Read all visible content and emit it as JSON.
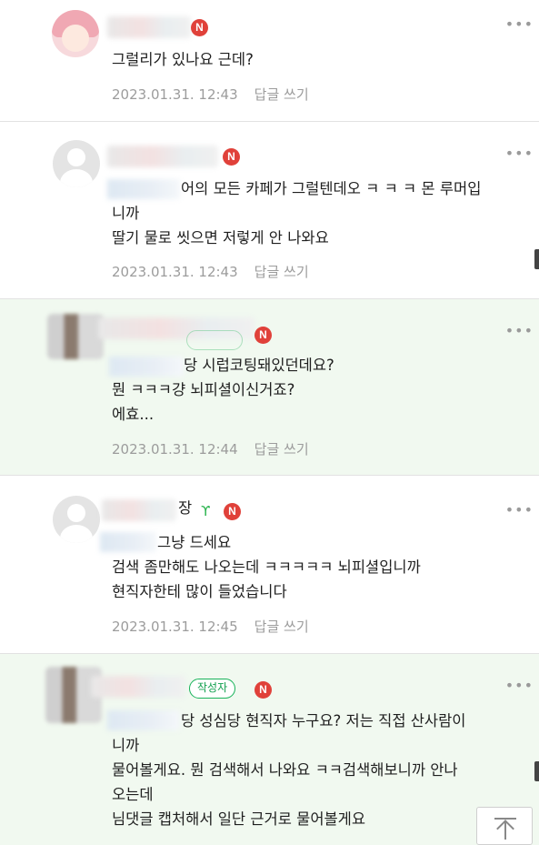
{
  "comments": [
    {
      "badge": "N",
      "lines": [
        "그럴리가 있나요 근데?"
      ],
      "date": "2023.01.31. 12:43",
      "reply": "답글 쓰기"
    },
    {
      "badge": "N",
      "lines": [
        "어의 모든 카페가 그럴텐데오 ㅋ ㅋ ㅋ 몬 루머입",
        "니까",
        "딸기 물로 씻으면 저렇게 안 나와요"
      ],
      "date": "2023.01.31. 12:43",
      "reply": "답글 쓰기"
    },
    {
      "badge": "N",
      "lines": [
        "당 시럽코팅돼있던데요?",
        "뭔 ㅋㅋㅋ걍 뇌피셜이신거죠?",
        "에효..."
      ],
      "date": "2023.01.31. 12:44",
      "reply": "답글 쓰기"
    },
    {
      "nick_fragment": "장",
      "badge": "N",
      "lines": [
        "그냥 드세요",
        "검색 좀만해도 나오는데 ㅋㅋㅋㅋㅋ 뇌피셜입니까",
        "현직자한테 많이 들었습니다"
      ],
      "date": "2023.01.31. 12:45",
      "reply": "답글 쓰기"
    },
    {
      "author_badge": "작성자",
      "badge": "N",
      "lines": [
        "당 성심당 현직자 누구요? 저는 직접 산사람이",
        "니까",
        "물어볼게요. 뭔 검색해서 나와요 ㅋㅋ검색해보니까 안나",
        "오는데",
        "님댓글 캡처해서 일단 근거로 물어볼게요"
      ]
    }
  ],
  "icons": {
    "more": "more-horizontal-icon",
    "scroll_top": "arrow-up-to-top-icon",
    "sprout": "sprout-icon"
  },
  "colors": {
    "highlight_bg": "#f1f9f0",
    "n_badge": "#e0413a",
    "author_badge": "#19b35a",
    "meta_text": "#9c9c9c"
  }
}
